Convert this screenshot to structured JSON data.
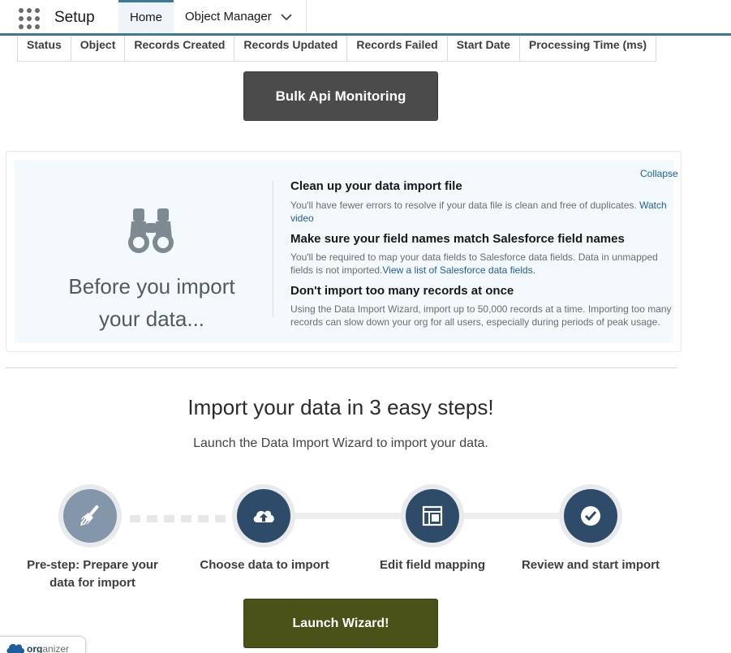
{
  "topnav": {
    "app_title": "Setup",
    "tabs": [
      {
        "label": "Home"
      },
      {
        "label": "Object Manager"
      }
    ]
  },
  "table": {
    "columns": [
      "Status",
      "Object",
      "Records Created",
      "Records Updated",
      "Records Failed",
      "Start Date",
      "Processing Time (ms)"
    ]
  },
  "bulk_button": {
    "label": "Bulk Api Monitoring"
  },
  "info_card": {
    "heading": "Before you import your data...",
    "collapse_label": "Collapse",
    "tips": [
      {
        "title": "Clean up your data import file",
        "text": "You'll have fewer errors to resolve if your data file is clean and free of duplicates. ",
        "link": "Watch video"
      },
      {
        "title": "Make sure your field names match Salesforce field names",
        "text": "You'll be required to map your data fields to Salesforce data fields. Data in unmapped fields is not imported.",
        "link": "View a list of Salesforce data fields."
      },
      {
        "title": "Don't import too many records at once",
        "text": "Using the Data Import Wizard, import up to 50,000 records at a time. Importing too many records can slow down your org for all users, especially during periods of peak usage.",
        "link": ""
      }
    ]
  },
  "import": {
    "heading": "Import your data in 3 easy steps!",
    "subheading": "Launch the Data Import Wizard to import your data.",
    "steps": [
      {
        "label": "Pre-step: Prepare your data for import",
        "icon": "broom-icon"
      },
      {
        "label": "Choose data to import",
        "icon": "cloud-upload-icon"
      },
      {
        "label": "Edit field mapping",
        "icon": "layout-icon"
      },
      {
        "label": "Review and start import",
        "icon": "check-icon"
      }
    ],
    "launch_label": "Launch Wizard!"
  },
  "organizer": {
    "brand_bold": "org",
    "brand_rest": "anizer"
  },
  "colors": {
    "nav_accent": "#3e7898",
    "step_dark": "#2e4b6a",
    "step_gray": "#8497aa",
    "launch_bg": "#4a5218",
    "bulk_bg": "#4b4b4b",
    "link": "#1b5f9e"
  }
}
